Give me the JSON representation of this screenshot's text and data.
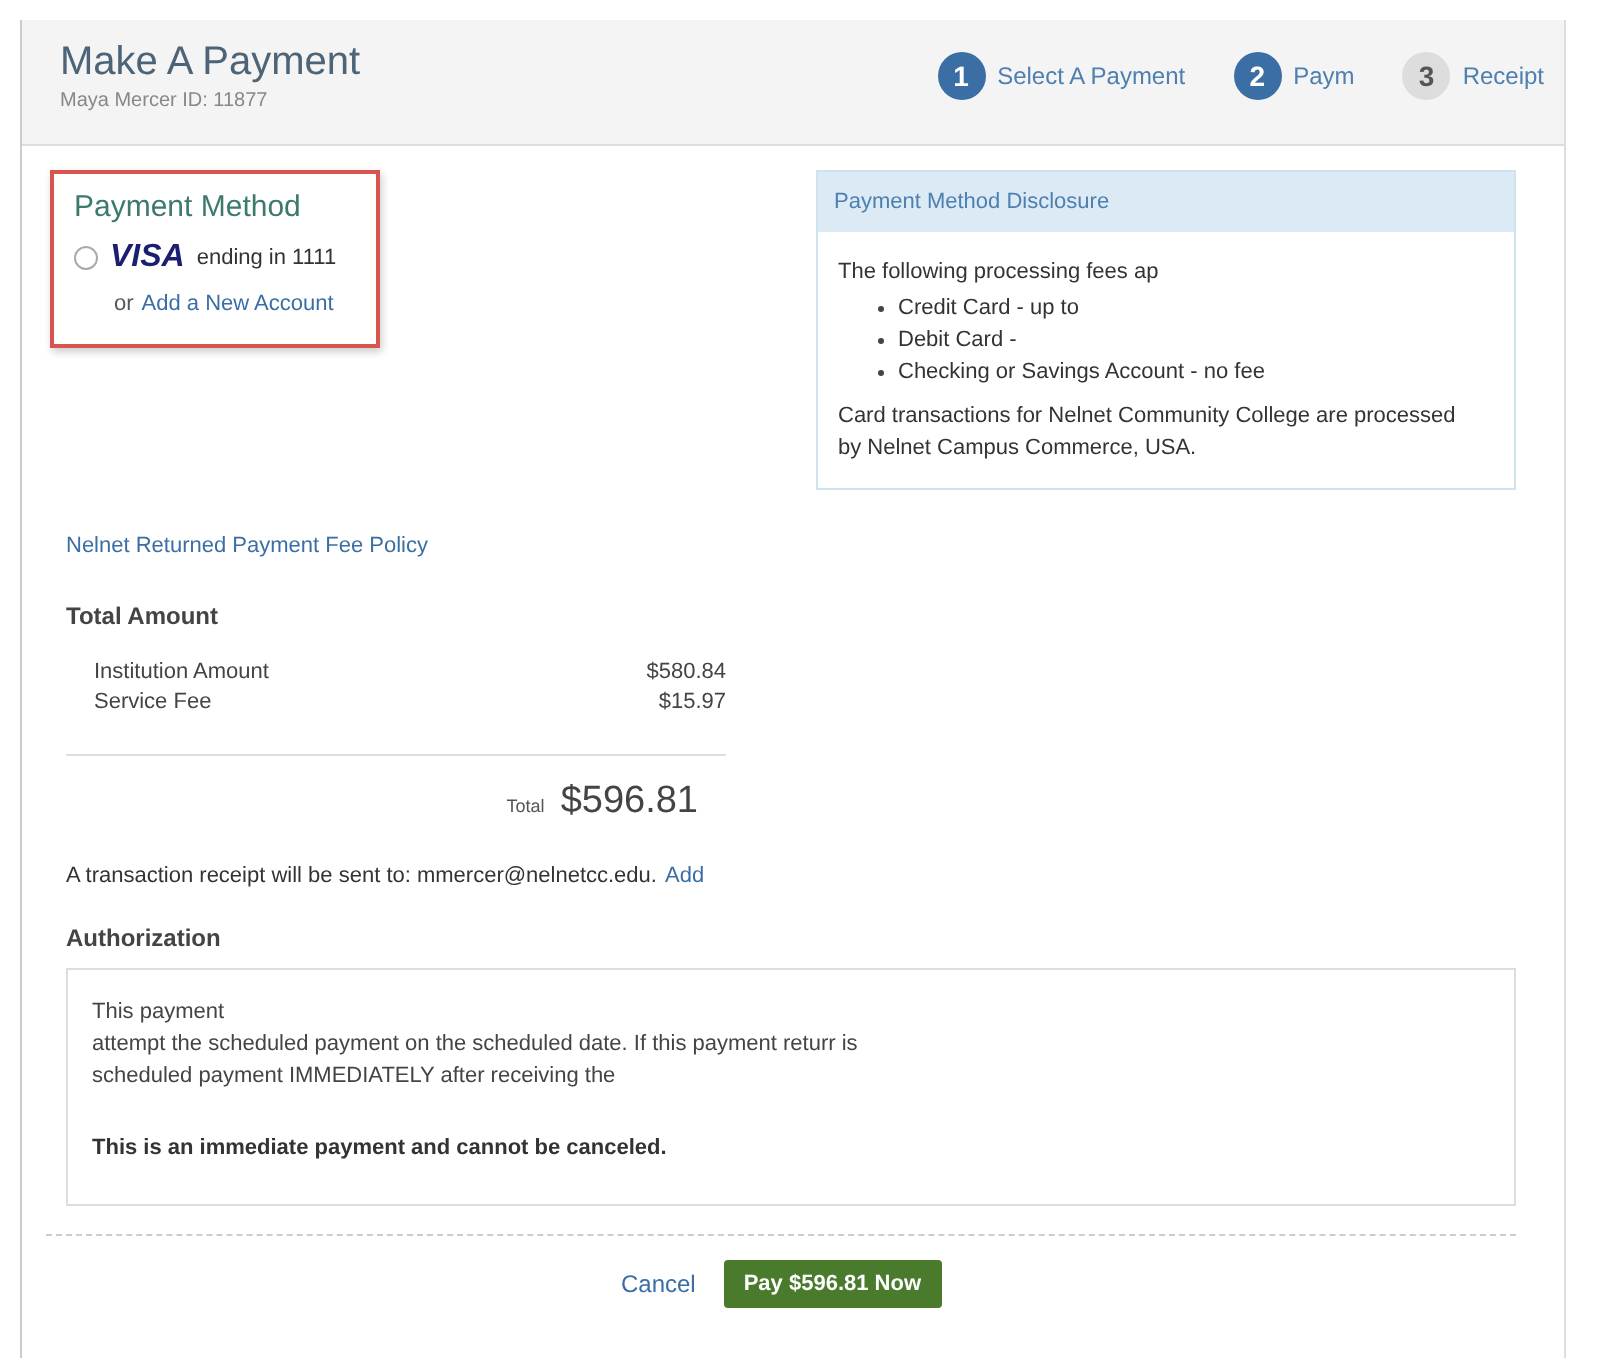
{
  "header": {
    "title": "Make A Payment",
    "subtitle": "Maya Mercer ID: 11877"
  },
  "steps": [
    {
      "number": "1",
      "label": "Select A Payment",
      "reached": true
    },
    {
      "number": "2",
      "label": "Paym",
      "reached": true
    },
    {
      "number": "3",
      "label": "Receipt",
      "reached": false
    }
  ],
  "payment_method": {
    "title": "Payment Method",
    "accounts": [
      {
        "brand": "VISA",
        "label": "ending in 1111",
        "selected": false
      }
    ],
    "add_prefix": "or",
    "add_link": "Add a New Account"
  },
  "disclosure": {
    "title": "Payment Method Disclosure",
    "intro": "The following processing fees ap",
    "fees": [
      "Credit Card - up to",
      "Debit Card -",
      "Checking or Savings Account - no fee"
    ],
    "note": "Card transactions for Nelnet Community College are processed by Nelnet Campus Commerce, USA."
  },
  "policy_link": "Nelnet Returned Payment Fee Policy",
  "total": {
    "title": "Total Amount",
    "lines": [
      {
        "label": "Institution Amount",
        "amount": "$580.84"
      },
      {
        "label": "Service Fee",
        "amount": "$15.97"
      }
    ],
    "total_label": "Total",
    "total_amount": "$596.81"
  },
  "receipt": {
    "text": "A transaction receipt will be sent to: mmercer@nelnetcc.edu.",
    "link": "Add"
  },
  "authorization": {
    "title": "Authorization",
    "lines": [
      "This payment",
      "attempt the scheduled payment on the scheduled date. If this payment returr is",
      "scheduled payment IMMEDIATELY after receiving the"
    ],
    "notice": "This is an immediate payment and cannot be canceled."
  },
  "buttons": {
    "cancel": "Cancel",
    "pay": "Pay $596.81 Now"
  }
}
